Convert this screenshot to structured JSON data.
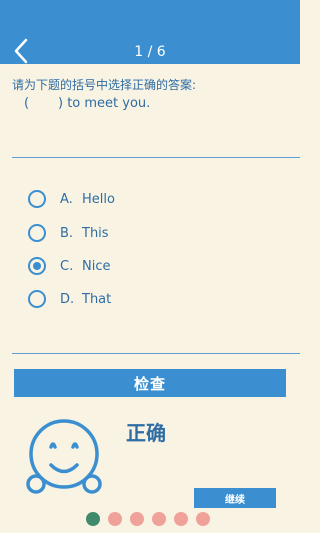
{
  "header": {
    "progress": "1 / 6"
  },
  "question": {
    "prompt": "请为下题的括号中选择正确的答案:",
    "sentence": "(       ) to meet you."
  },
  "options": [
    {
      "letter": "A.",
      "text": "Hello",
      "selected": false
    },
    {
      "letter": "B.",
      "text": "This",
      "selected": false
    },
    {
      "letter": "C.",
      "text": "Nice",
      "selected": true
    },
    {
      "letter": "D.",
      "text": "That",
      "selected": false
    }
  ],
  "actions": {
    "check_label": "检查",
    "continue_label": "继续"
  },
  "result": {
    "text": "正确",
    "icon": "smiley-icon"
  },
  "progress_dots": [
    {
      "state": "done",
      "color": "#3f8a6b"
    },
    {
      "state": "pending",
      "color": "#f0a29a"
    },
    {
      "state": "pending",
      "color": "#f0a29a"
    },
    {
      "state": "pending",
      "color": "#f0a29a"
    },
    {
      "state": "pending",
      "color": "#f0a29a"
    },
    {
      "state": "pending",
      "color": "#f0a29a"
    }
  ],
  "colors": {
    "accent": "#3b8fd0",
    "text": "#2e6da4",
    "background": "#f8f3e3"
  }
}
